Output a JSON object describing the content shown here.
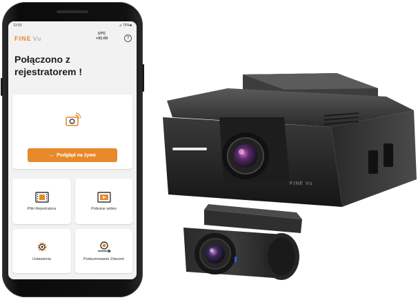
{
  "status_bar": {
    "time": "13:53",
    "indicators": "⊿ 75%■"
  },
  "app": {
    "logo_main": "FINE",
    "logo_sub": "Vu",
    "utc_label": "UTC",
    "utc_offset": "+01:00",
    "help_icon": "?"
  },
  "main": {
    "headline": "Połączono z rejestratorem !",
    "live_button_label": "Podgląd na żywo",
    "live_button_icon": "↔"
  },
  "tiles": [
    {
      "label": "Pliki Rejestratora",
      "icon": "film-strip-icon"
    },
    {
      "label": "Pobrane wideo",
      "icon": "downloaded-video-icon"
    },
    {
      "label": "Ustawienia",
      "icon": "gear-icon"
    },
    {
      "label": "Podsumowanie Zdarzeń",
      "icon": "event-summary-icon"
    }
  ],
  "device": {
    "brand_print": "FINE Vu"
  },
  "colors": {
    "accent": "#e8892b",
    "screen_bg": "#f2f2f2",
    "card_bg": "#ffffff"
  }
}
